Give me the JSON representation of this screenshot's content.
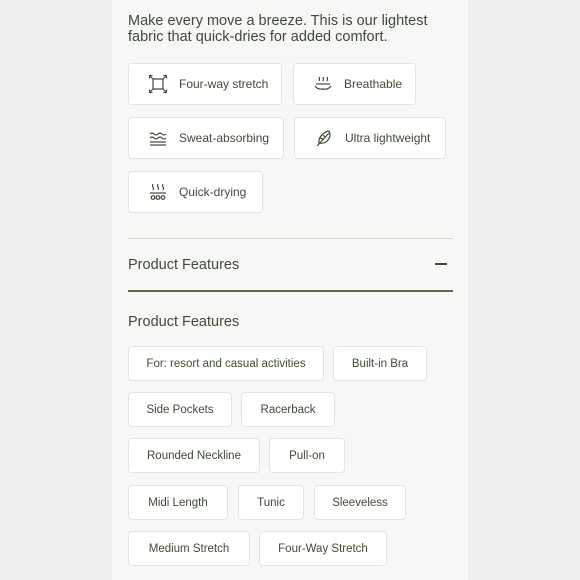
{
  "intro": "Make every move a breeze. This is our lightest fabric that quick-dries for added comfort.",
  "fabric_features": [
    {
      "label": "Four-way stretch",
      "icon": "four-way-stretch-icon"
    },
    {
      "label": "Breathable",
      "icon": "breathable-icon"
    },
    {
      "label": "Sweat-absorbing",
      "icon": "sweat-absorbing-icon"
    },
    {
      "label": "Ultra lightweight",
      "icon": "feather-icon"
    },
    {
      "label": "Quick-drying",
      "icon": "quick-drying-icon"
    }
  ],
  "accordion": {
    "title": "Product Features",
    "expanded": true
  },
  "product_features": {
    "title": "Product Features",
    "tags": [
      "For: resort and casual activities",
      "Built-in Bra",
      "Side Pockets",
      "Racerback",
      "Rounded Neckline",
      "Pull-on",
      "Midi Length",
      "Tunic",
      "Sleeveless",
      "Medium Stretch",
      "Four-Way Stretch"
    ]
  },
  "colors": {
    "text": "#3e4c37",
    "accent_line": "#5b6a51",
    "chip_bg": "#ffffff"
  }
}
